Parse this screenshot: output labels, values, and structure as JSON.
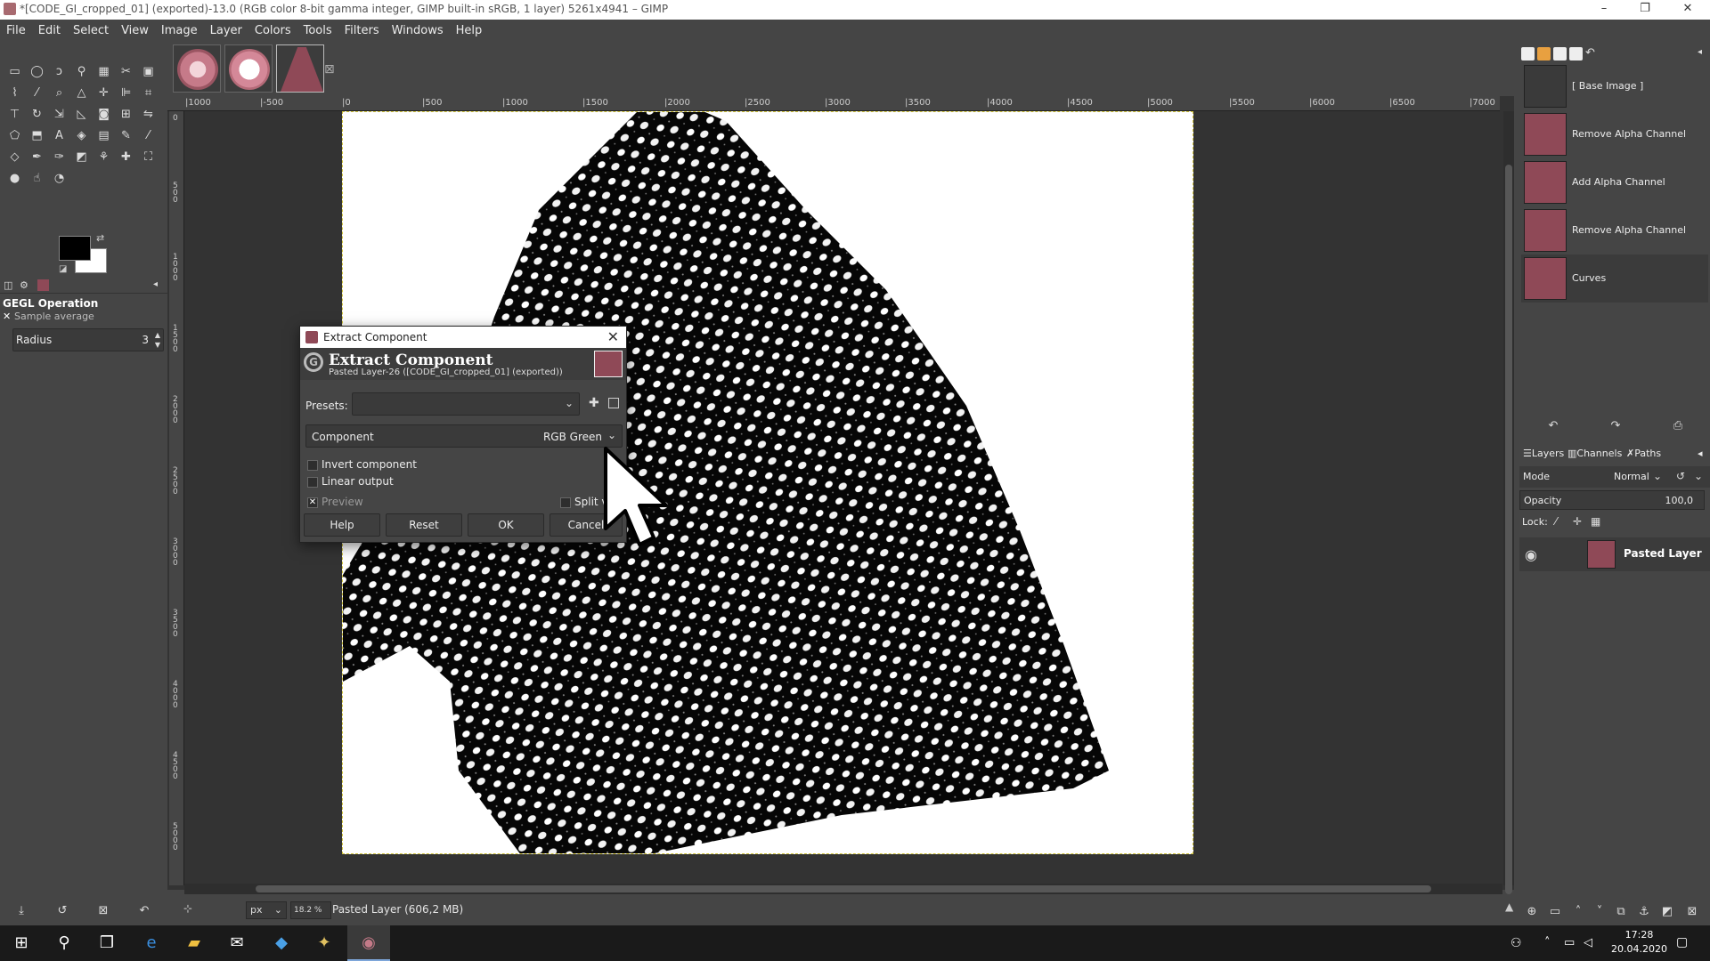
{
  "window": {
    "title": "*[CODE_GI_cropped_01] (exported)-13.0 (RGB color 8-bit gamma integer, GIMP built-in sRGB, 1 layer) 5261x4941 – GIMP",
    "controls": [
      "–",
      "❐",
      "✕"
    ]
  },
  "menu": [
    "File",
    "Edit",
    "Select",
    "View",
    "Image",
    "Layer",
    "Colors",
    "Tools",
    "Filters",
    "Windows",
    "Help"
  ],
  "tool_options": {
    "title": "GEGL Operation",
    "sample": "Sample average",
    "radius_label": "Radius",
    "radius_value": "3"
  },
  "ruler": {
    "h_ticks": [
      "|1000",
      "|-500",
      "|0",
      "|500",
      "|1000",
      "|1500",
      "|2000",
      "|2500",
      "|3000",
      "|3500",
      "|4000",
      "|4500",
      "|5000",
      "|5500",
      "|6000",
      "|6500",
      "|7000"
    ],
    "v_ticks": [
      "0",
      "500",
      "1000",
      "1500",
      "2000",
      "2500",
      "3000",
      "3500",
      "4000",
      "4500",
      "5000"
    ]
  },
  "status": {
    "unit": "px",
    "zoom": "18.2 %",
    "info": "Pasted Layer (606,2 MB)"
  },
  "undo_history": [
    {
      "label": "[ Base Image ]"
    },
    {
      "label": "Remove Alpha Channel"
    },
    {
      "label": "Add Alpha Channel"
    },
    {
      "label": "Remove Alpha Channel"
    },
    {
      "label": "Curves"
    }
  ],
  "layers_panel": {
    "tabs": [
      "Layers",
      "Channels",
      "Paths"
    ],
    "mode_label": "Mode",
    "mode_value": "Normal",
    "opacity_label": "Opacity",
    "opacity_value": "100,0",
    "lock_label": "Lock:",
    "layers": [
      {
        "name": "Pasted Layer"
      }
    ]
  },
  "dialog": {
    "window_title": "Extract Component",
    "header_title": "Extract Component",
    "header_subtitle": "Pasted Layer-26 ([CODE_GI_cropped_01] (exported))",
    "presets_label": "Presets:",
    "component_label": "Component",
    "component_value": "RGB Green",
    "invert_label": "Invert component",
    "linear_label": "Linear output",
    "preview_label": "Preview",
    "split_label": "Split view",
    "buttons": {
      "help": "Help",
      "reset": "Reset",
      "ok": "OK",
      "cancel": "Cancel"
    }
  },
  "taskbar": {
    "time": "17:28",
    "date": "20.04.2020"
  },
  "colors": {
    "fg": "#000000",
    "bg": "#ffffff",
    "panel": "#454545",
    "canvas_bg": "#333333"
  }
}
